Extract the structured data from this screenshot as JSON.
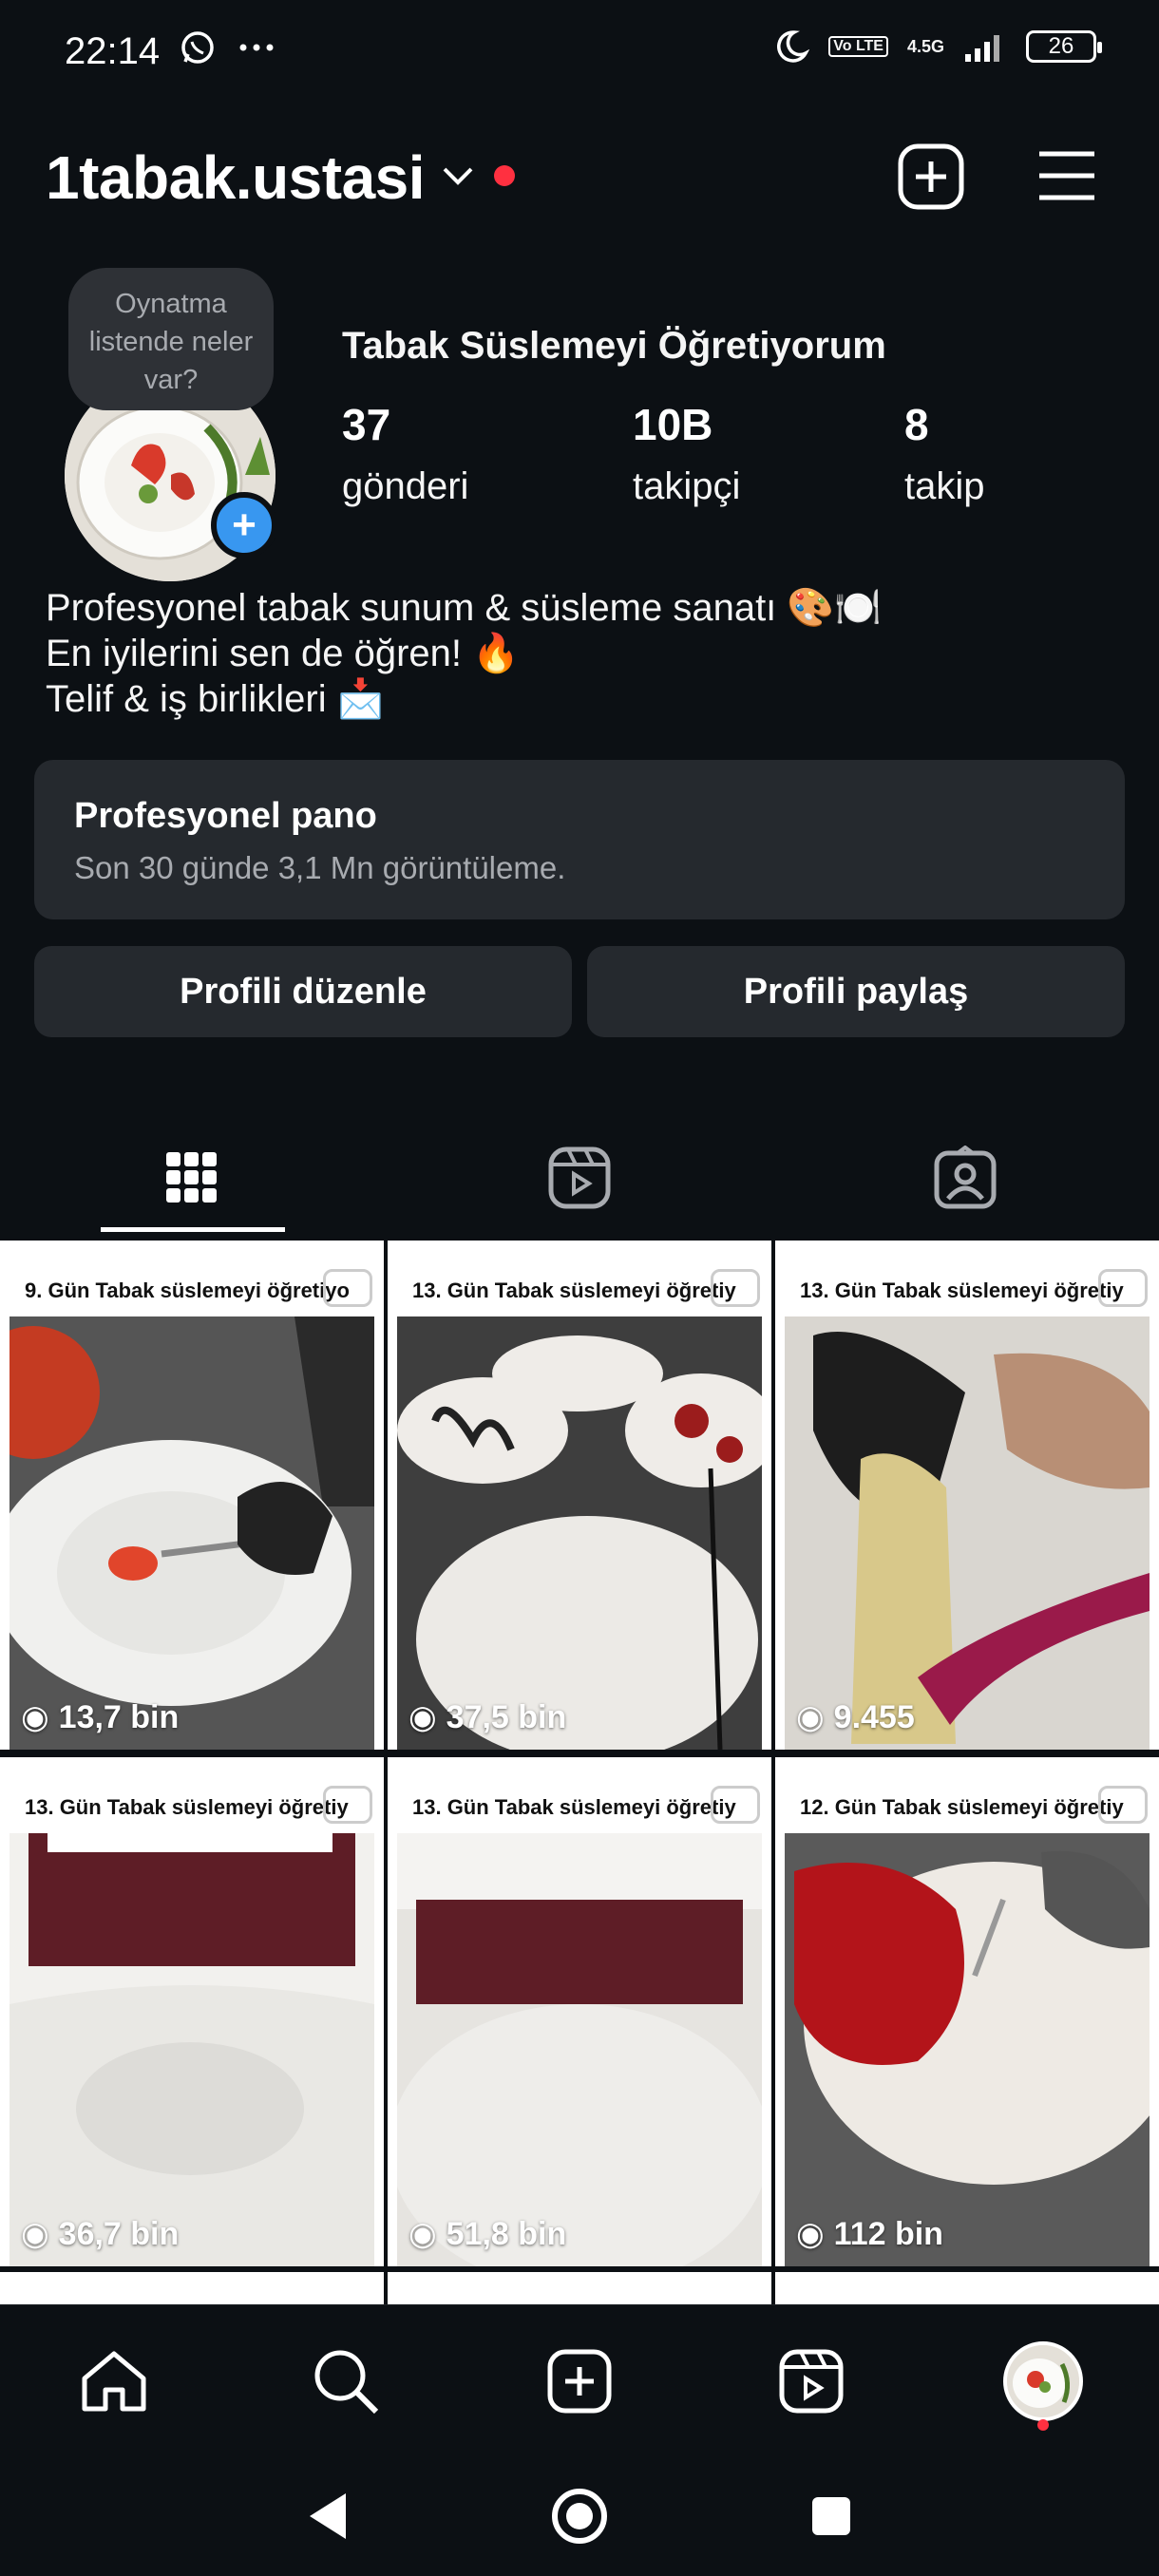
{
  "status_bar": {
    "time": "22:14",
    "network": "4.5G",
    "battery": "26",
    "lte_label": "Vo LTE"
  },
  "header": {
    "username": "1tabak.ustasi"
  },
  "profile": {
    "note": "Oynatma listende neler var?",
    "display_name": "Tabak Süslemeyi Öğretiyorum",
    "stats": [
      {
        "value": "37",
        "label": "gönderi"
      },
      {
        "value": "10B",
        "label": "takipçi"
      },
      {
        "value": "8",
        "label": "takip"
      }
    ],
    "bio": [
      "Profesyonel tabak sunum & süsleme sanatı 🎨🍽️",
      "En iyilerini sen de öğren! 🔥",
      "Telif & iş birlikleri 📩"
    ]
  },
  "dashboard": {
    "title": "Profesyonel pano",
    "subtitle": "Son 30 günde 3,1 Mn görüntüleme."
  },
  "buttons": {
    "edit": "Profili düzenle",
    "share": "Profili paylaş"
  },
  "tabs": [
    "grid-icon",
    "reels-icon",
    "tagged-icon"
  ],
  "posts": [
    {
      "caption": "9. Gün Tabak süslemeyi öğretiyo",
      "views": "13,7 bin"
    },
    {
      "caption": "13. Gün Tabak süslemeyi öğretiy",
      "views": "37,5 bin"
    },
    {
      "caption": "13. Gün Tabak süslemeyi öğretiy",
      "views": "9.455"
    },
    {
      "caption": "13. Gün Tabak süslemeyi öğretiy",
      "views": "36,7 bin"
    },
    {
      "caption": "13. Gün Tabak süslemeyi öğretiy",
      "views": "51,8 bin"
    },
    {
      "caption": "12. Gün Tabak süslemeyi öğretiy",
      "views": "112 bin"
    }
  ],
  "colors": {
    "background": "#0c1014",
    "card": "#25292e",
    "accent_blue": "#3897f0",
    "notification_red": "#ff3040"
  }
}
